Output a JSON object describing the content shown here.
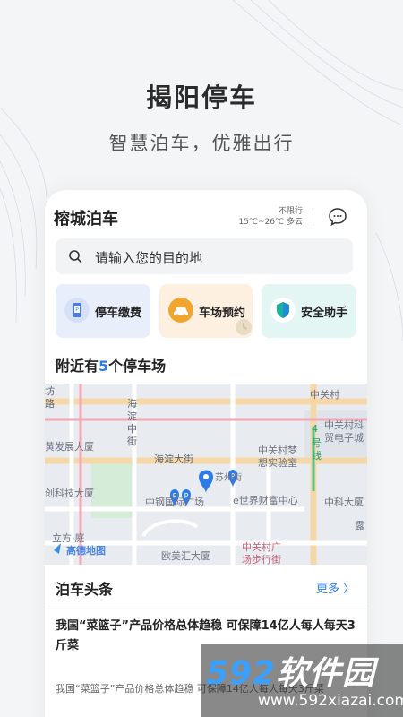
{
  "hero": {
    "title": "揭阳停车",
    "subtitle": "智慧泊车，优雅出行"
  },
  "app": {
    "name": "榕城泊车",
    "weather_limit": "不限行",
    "weather_temp": "15℃~26℃ 多云",
    "message_icon": "chat-bubble-icon"
  },
  "search": {
    "placeholder": "请输入您的目的地",
    "icon": "search-icon"
  },
  "quick_actions": [
    {
      "label": "停车缴费",
      "icon": "phone-card-icon",
      "color": "#4a7be0"
    },
    {
      "label": "车场预约",
      "icon": "car-clock-icon",
      "color": "#f1a531"
    },
    {
      "label": "安全助手",
      "icon": "shield-icon",
      "color": "#19b39b"
    }
  ],
  "nearby": {
    "prefix": "附近有",
    "count": "5",
    "suffix": "个停车场"
  },
  "map": {
    "labels": {
      "l1": "坊",
      "l2": "路",
      "l3": "海",
      "l4": "淀",
      "l5": "中",
      "l6": "街",
      "l7": "中关村",
      "l8": "中关村科",
      "l9": "贸电子城",
      "l10": "黄发展大厦",
      "l11": "4",
      "l12": "号",
      "l13": "线",
      "l14": "中关村梦",
      "l15": "想实验室",
      "l16": "海淀大街",
      "l17": "创科技大厦",
      "l18": "中钢国际广场",
      "l19": "e世界财富中心",
      "l20": "中科大厦",
      "l21": "立方·庭",
      "l22": "欧美汇大厦",
      "l23": "中关村广",
      "l24": "场步行街",
      "l25": "露",
      "l26": "苏州街"
    },
    "logo": "高德地图"
  },
  "news": {
    "title": "泊车头条",
    "more": "更多 〉",
    "article_title": "我国“菜篮子”产品价格总体趋稳 可保障14亿人每人每天3斤菜",
    "article_body": "我国“菜篮子”产品价格总体趋稳 可保障14亿人每人每天3斤菜"
  },
  "watermark": {
    "logo_num": "592",
    "logo_text": "软件园",
    "url": "www.592xiazai.com"
  }
}
